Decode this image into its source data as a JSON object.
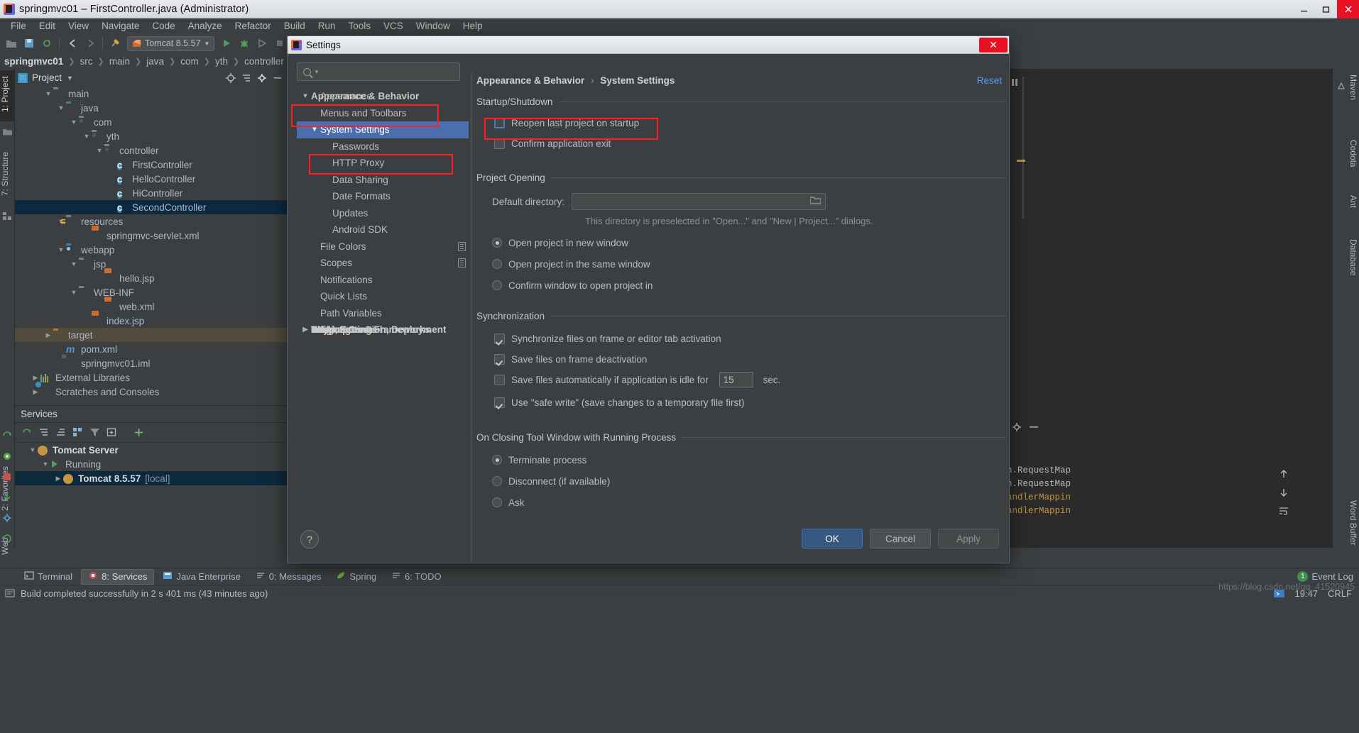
{
  "window": {
    "title": "springmvc01 – FirstController.java (Administrator)",
    "icon": "intellij-logo-icon",
    "minimize": "minimize-icon",
    "maximize": "maximize-icon",
    "close": "close-icon"
  },
  "menubar": {
    "items": [
      {
        "label": "File",
        "mnemonic": "F"
      },
      {
        "label": "Edit",
        "mnemonic": "E"
      },
      {
        "label": "View",
        "mnemonic": "V"
      },
      {
        "label": "Navigate",
        "mnemonic": "N"
      },
      {
        "label": "Code",
        "mnemonic": "C"
      },
      {
        "label": "Analyze",
        "mnemonic": "z"
      },
      {
        "label": "Refactor",
        "mnemonic": "R"
      },
      {
        "label": "Build",
        "mnemonic": "B"
      },
      {
        "label": "Run",
        "mnemonic": "u"
      },
      {
        "label": "Tools",
        "mnemonic": "T"
      },
      {
        "label": "VCS",
        "mnemonic": "S"
      },
      {
        "label": "Window",
        "mnemonic": "W"
      },
      {
        "label": "Help",
        "mnemonic": "H"
      }
    ]
  },
  "toolbar": {
    "run_config": "Tomcat 8.5.57",
    "icons": [
      "open-folder-icon",
      "save-all-icon",
      "sync-refresh-icon",
      "back-arrow-icon",
      "forward-arrow-icon",
      "build-hammer-icon",
      "run-icon",
      "debug-icon",
      "stop-icon",
      "search-everywhere-icon",
      "settings-gear-icon"
    ]
  },
  "breadcrumb": {
    "items": [
      "springmvc01",
      "src",
      "main",
      "java",
      "com",
      "yth",
      "controller"
    ]
  },
  "left_strip": {
    "tabs": [
      {
        "label": "1: Project",
        "mnemonic": "1",
        "selected": true
      },
      {
        "label": "7: Structure",
        "mnemonic": "7",
        "selected": false
      },
      {
        "label": "2: Favorites",
        "mnemonic": "2",
        "selected": false
      },
      {
        "label": "Web",
        "mnemonic": "",
        "selected": false
      }
    ]
  },
  "right_strip": {
    "tabs": [
      "Maven",
      "Codota",
      "Ant",
      "Database",
      "Word Buffer"
    ]
  },
  "project_panel": {
    "title": "Project",
    "header_icons": [
      "locate-target-icon",
      "collapse-all-icon",
      "gear-icon",
      "hide-icon"
    ],
    "tree": [
      {
        "indent": 2,
        "twisty": "down",
        "icon": "folder-grey",
        "label": "main"
      },
      {
        "indent": 3,
        "twisty": "down",
        "icon": "folder-blue",
        "label": "java"
      },
      {
        "indent": 4,
        "twisty": "down",
        "icon": "folder-pkg",
        "label": "com"
      },
      {
        "indent": 5,
        "twisty": "down",
        "icon": "folder-pkg",
        "label": "yth"
      },
      {
        "indent": 6,
        "twisty": "down",
        "icon": "folder-pkg",
        "label": "controller"
      },
      {
        "indent": 7,
        "twisty": "none",
        "icon": "class-icon",
        "label": "FirstController"
      },
      {
        "indent": 7,
        "twisty": "none",
        "icon": "class-icon",
        "label": "HelloController"
      },
      {
        "indent": 7,
        "twisty": "none",
        "icon": "class-icon",
        "label": "HiController"
      },
      {
        "indent": 7,
        "twisty": "none",
        "icon": "class-icon",
        "label": "SecondController",
        "state": "selected"
      },
      {
        "indent": 3,
        "twisty": "down",
        "icon": "folder-res",
        "label": "resources"
      },
      {
        "indent": 5,
        "twisty": "none",
        "icon": "xml-spring",
        "label": "springmvc-servlet.xml"
      },
      {
        "indent": 3,
        "twisty": "down",
        "icon": "folder-web",
        "label": "webapp"
      },
      {
        "indent": 4,
        "twisty": "down",
        "icon": "folder-grey",
        "label": "jsp"
      },
      {
        "indent": 6,
        "twisty": "none",
        "icon": "jsp-icon",
        "label": "hello.jsp"
      },
      {
        "indent": 4,
        "twisty": "down",
        "icon": "folder-grey",
        "label": "WEB-INF"
      },
      {
        "indent": 6,
        "twisty": "none",
        "icon": "xml-web",
        "label": "web.xml"
      },
      {
        "indent": 5,
        "twisty": "none",
        "icon": "jsp-icon",
        "label": "index.jsp"
      },
      {
        "indent": 2,
        "twisty": "right",
        "icon": "folder-orange",
        "label": "target",
        "state": "target"
      },
      {
        "indent": 3,
        "twisty": "none",
        "icon": "maven-icon",
        "label": "pom.xml"
      },
      {
        "indent": 3,
        "twisty": "none",
        "icon": "iml-icon",
        "label": "springmvc01.iml"
      },
      {
        "indent": 1,
        "twisty": "right",
        "icon": "ext-lib-icon",
        "label": "External Libraries"
      },
      {
        "indent": 1,
        "twisty": "right",
        "icon": "scratch-icon",
        "label": "Scratches and Consoles"
      }
    ]
  },
  "services_panel": {
    "title": "Services",
    "toolbar_icons": [
      "rerun-icon",
      "expand-all-icon",
      "collapse-all-icon",
      "group-icon",
      "filter-icon",
      "add-tab-icon",
      "add-icon"
    ],
    "rows": [
      {
        "indent": 1,
        "twisty": "down",
        "icon": "tomcat-icon",
        "label": "Tomcat Server",
        "bold": true
      },
      {
        "indent": 2,
        "twisty": "down",
        "icon": "run-green-icon",
        "label": "Running",
        "bold": false
      },
      {
        "indent": 3,
        "twisty": "right",
        "icon": "tomcat-icon",
        "label": "Tomcat 8.5.57",
        "suffix": "[local]",
        "bold": true,
        "state": "selected"
      }
    ]
  },
  "console": {
    "lines": [
      "n.RequestMap",
      "n.RequestMap",
      "andlerMappin",
      "andlerMappin"
    ],
    "side_icons": [
      "scroll-up-icon",
      "scroll-down-icon",
      "soft-wrap-icon"
    ]
  },
  "bottom_tabs": {
    "items": [
      {
        "label": "Terminal",
        "mnemonic": "",
        "icon": "terminal-icon",
        "selected": false
      },
      {
        "label": "8: Services",
        "mnemonic": "8",
        "icon": "services-icon",
        "selected": true
      },
      {
        "label": "Java Enterprise",
        "mnemonic": "",
        "icon": "java-ee-icon",
        "selected": false
      },
      {
        "label": "0: Messages",
        "mnemonic": "0",
        "icon": "messages-icon",
        "selected": false
      },
      {
        "label": "Spring",
        "mnemonic": "",
        "icon": "spring-leaf-icon",
        "selected": false
      },
      {
        "label": "6: TODO",
        "mnemonic": "6",
        "icon": "todo-icon",
        "selected": false
      }
    ],
    "event_log": {
      "label": "Event Log",
      "badge": "1"
    }
  },
  "status_bar": {
    "message": "Build completed successfully in 2 s 401 ms (43 minutes ago)",
    "time": "19:47",
    "line_sep": "CRLF",
    "icons": [
      "info-icon",
      "ide-running-icon"
    ],
    "watermark": "https://blog.csdn.net/qq_41520945"
  },
  "settings_dialog": {
    "title": "Settings",
    "icon": "intellij-logo-icon",
    "close_label": "✕",
    "search": {
      "placeholder": "",
      "value": "",
      "icon": "search-icon"
    },
    "reset_label": "Reset",
    "breadcrumb": {
      "parent": "Appearance & Behavior",
      "sep": "›",
      "current": "System Settings"
    },
    "tree": [
      {
        "indent": 0,
        "twisty": "down",
        "label": "Appearance & Behavior",
        "group": true,
        "highlight": "red-box"
      },
      {
        "indent": 1,
        "twisty": "none",
        "label": "Appearance"
      },
      {
        "indent": 1,
        "twisty": "none",
        "label": "Menus and Toolbars"
      },
      {
        "indent": 1,
        "twisty": "down",
        "label": "System Settings",
        "selected": true,
        "highlight": "red-box"
      },
      {
        "indent": 2,
        "twisty": "none",
        "label": "Passwords"
      },
      {
        "indent": 2,
        "twisty": "none",
        "label": "HTTP Proxy"
      },
      {
        "indent": 2,
        "twisty": "none",
        "label": "Data Sharing"
      },
      {
        "indent": 2,
        "twisty": "none",
        "label": "Date Formats"
      },
      {
        "indent": 2,
        "twisty": "none",
        "label": "Updates"
      },
      {
        "indent": 2,
        "twisty": "none",
        "label": "Android SDK"
      },
      {
        "indent": 1,
        "twisty": "none",
        "label": "File Colors",
        "badge": "copy-badge-icon"
      },
      {
        "indent": 1,
        "twisty": "none",
        "label": "Scopes",
        "badge": "copy-badge-icon"
      },
      {
        "indent": 1,
        "twisty": "none",
        "label": "Notifications"
      },
      {
        "indent": 1,
        "twisty": "none",
        "label": "Quick Lists"
      },
      {
        "indent": 1,
        "twisty": "none",
        "label": "Path Variables"
      },
      {
        "indent": 0,
        "twisty": "none",
        "label": "Keymap",
        "group": true
      },
      {
        "indent": 0,
        "twisty": "right",
        "label": "Editor",
        "group": true
      },
      {
        "indent": 0,
        "twisty": "none",
        "label": "Plugins",
        "group": true,
        "count_badge": "1"
      },
      {
        "indent": 0,
        "twisty": "right",
        "label": "Version Control",
        "group": true,
        "badge": "copy-badge-icon"
      },
      {
        "indent": 0,
        "twisty": "right",
        "label": "Build, Execution, Deployment",
        "group": true
      },
      {
        "indent": 0,
        "twisty": "right",
        "label": "Languages & Frameworks",
        "group": true
      },
      {
        "indent": 0,
        "twisty": "right",
        "label": "Tools",
        "group": true
      },
      {
        "indent": 0,
        "twisty": "right",
        "label": "Other Settings",
        "group": true
      }
    ],
    "sections": {
      "startup": {
        "title": "Startup/Shutdown",
        "reopen": {
          "label": "Reopen last project on startup",
          "checked": false,
          "focused": true,
          "highlight": "red-box"
        },
        "confirm_exit": {
          "label": "Confirm application exit",
          "checked": false
        }
      },
      "project_opening": {
        "title": "Project Opening",
        "default_directory": {
          "label": "Default directory:",
          "value": "",
          "browse_icon": "folder-browse-icon"
        },
        "hint": "This directory is preselected in \"Open...\" and \"New | Project...\" dialogs.",
        "options": [
          {
            "label": "Open project in new window",
            "selected": true
          },
          {
            "label": "Open project in the same window",
            "selected": false
          },
          {
            "label": "Confirm window to open project in",
            "selected": false
          }
        ]
      },
      "synchronization": {
        "title": "Synchronization",
        "items": [
          {
            "label": "Synchronize files on frame or editor tab activation",
            "checked": true
          },
          {
            "label": "Save files on frame deactivation",
            "checked": true
          },
          {
            "label": "Save files automatically if application is idle for",
            "checked": false,
            "value": "15",
            "suffix": "sec."
          },
          {
            "label": "Use \"safe write\" (save changes to a temporary file first)",
            "checked": true
          }
        ]
      },
      "closing_tool_window": {
        "title": "On Closing Tool Window with Running Process",
        "options": [
          {
            "label": "Terminate process",
            "selected": true
          },
          {
            "label": "Disconnect (if available)",
            "selected": false
          },
          {
            "label": "Ask",
            "selected": false
          }
        ]
      }
    },
    "footer": {
      "help": "?",
      "ok": "OK",
      "cancel": "Cancel",
      "apply": "Apply"
    }
  },
  "colors": {
    "accent_blue": "#4b6eaf",
    "highlight_red": "#ff2020",
    "panel_bg": "#3c3f41",
    "editor_bg": "#2b2b2b",
    "selection_bg": "#0d293e",
    "link_blue": "#589df6"
  }
}
